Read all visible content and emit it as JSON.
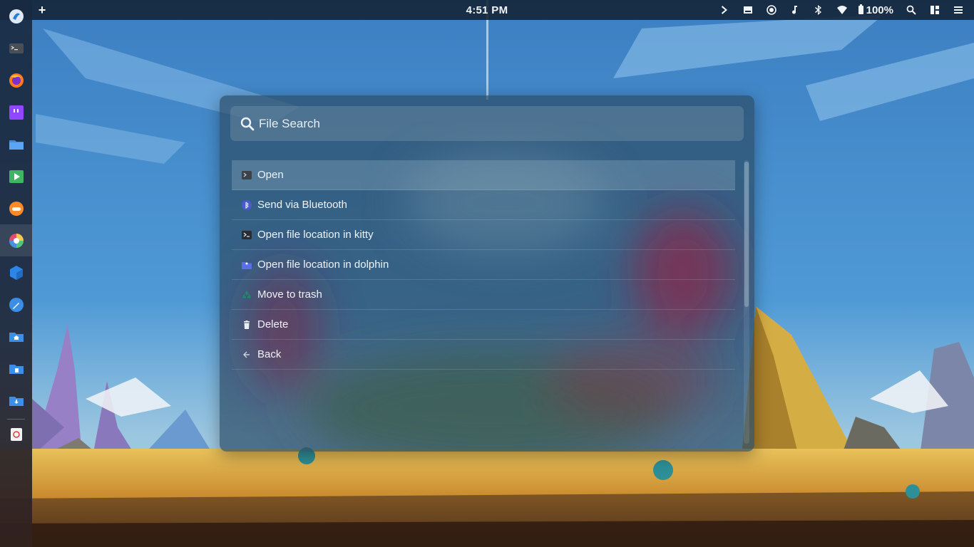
{
  "topbar": {
    "add_label": "+",
    "clock": "4:51 PM",
    "battery": "100%",
    "tray_icons": [
      "chevron-right-icon",
      "drive-icon",
      "record-icon",
      "music-icon",
      "bluetooth-icon",
      "wifi-icon",
      "battery-icon",
      "search-icon",
      "layout-icon",
      "menu-icon"
    ]
  },
  "dock": {
    "apps": [
      "app-launcher",
      "terminal",
      "firefox",
      "twitch",
      "file-manager",
      "media-player",
      "game-controller",
      "color-picker",
      "box-app",
      "pen-tool",
      "home-folder",
      "documents-folder",
      "downloads-folder",
      "trash"
    ]
  },
  "launcher": {
    "search_placeholder": "File Search",
    "results": [
      {
        "label": "Open",
        "icon": "terminal-icon",
        "selected": true
      },
      {
        "label": "Send via Bluetooth",
        "icon": "bluetooth-icon",
        "selected": false
      },
      {
        "label": "Open file location in kitty",
        "icon": "terminal-icon",
        "selected": false
      },
      {
        "label": "Open file location in dolphin",
        "icon": "folder-icon",
        "selected": false
      },
      {
        "label": "Move to trash",
        "icon": "recycle-icon",
        "selected": false
      },
      {
        "label": "Delete",
        "icon": "trash-icon",
        "selected": false
      },
      {
        "label": "Back",
        "icon": "back-arrow-icon",
        "selected": false
      }
    ]
  },
  "colors": {
    "topbar_bg": "#122234",
    "launcher_bg": "#2e4e68",
    "selected_row": "#6c8ca2"
  }
}
